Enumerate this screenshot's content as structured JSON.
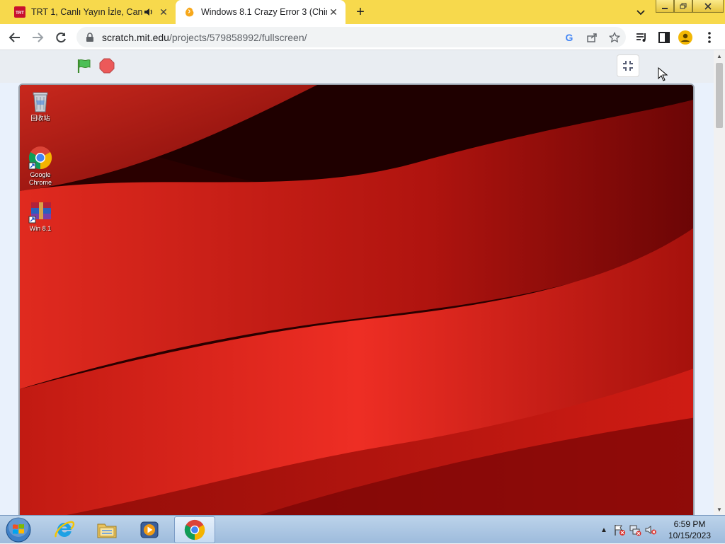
{
  "browser": {
    "tabs": [
      {
        "title": "TRT 1, Canlı Yayın İzle, Canlı Yayı",
        "favicon": "trt-icon",
        "audio": true,
        "active": false
      },
      {
        "title": "Windows 8.1 Crazy Error 3 (Chinese",
        "favicon": "scratch-icon",
        "audio": false,
        "active": true
      }
    ],
    "new_tab": "+",
    "url_host": "scratch.mit.edu",
    "url_path": "/projects/579858992/fullscreen/",
    "accent_color": "#f7d94c"
  },
  "desktop": {
    "icons": [
      {
        "label": "回收站",
        "icon": "recycle-bin-icon"
      },
      {
        "label": "Google Chrome",
        "icon": "chrome-icon"
      },
      {
        "label": "Win 8.1",
        "icon": "winrar-icon"
      }
    ],
    "wallpaper_color": "#b31b14"
  },
  "taskbar": {
    "apps": [
      "internet-explorer-icon",
      "file-explorer-icon",
      "media-player-icon",
      "chrome-icon"
    ],
    "clock_time": "6:59 PM",
    "clock_date": "10/15/2023"
  }
}
